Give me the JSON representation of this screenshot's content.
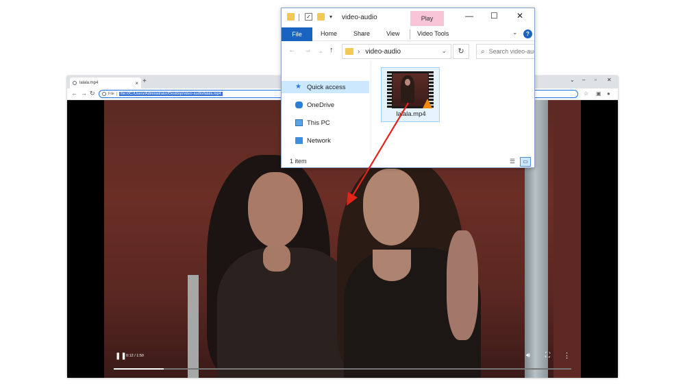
{
  "browser": {
    "tab_title": "lalala.mp4",
    "tab_close": "×",
    "new_tab": "+",
    "scheme_label": "File",
    "url": "file:///C:/Users/Administrator/Desktop/video-audio/lalala.mp4",
    "video": {
      "time": "0:12 / 1:50",
      "progress": 0.11
    }
  },
  "explorer": {
    "title": "video-audio",
    "contextual_tab": "Play",
    "ribbon_tabs": [
      "File",
      "Home",
      "Share",
      "View",
      "Video Tools"
    ],
    "help": "?",
    "path": "video-audio",
    "search_placeholder": "Search video-audio",
    "nav_items": [
      "Quick access",
      "OneDrive",
      "This PC",
      "Network"
    ],
    "file_name": "lalala.mp4",
    "status": "1 item"
  },
  "colors": {
    "ribbon_file": "#1a63c1",
    "play_tab": "#f7c5d7",
    "selection": "#cce8ff",
    "drag_arrow": "#e3241b"
  }
}
